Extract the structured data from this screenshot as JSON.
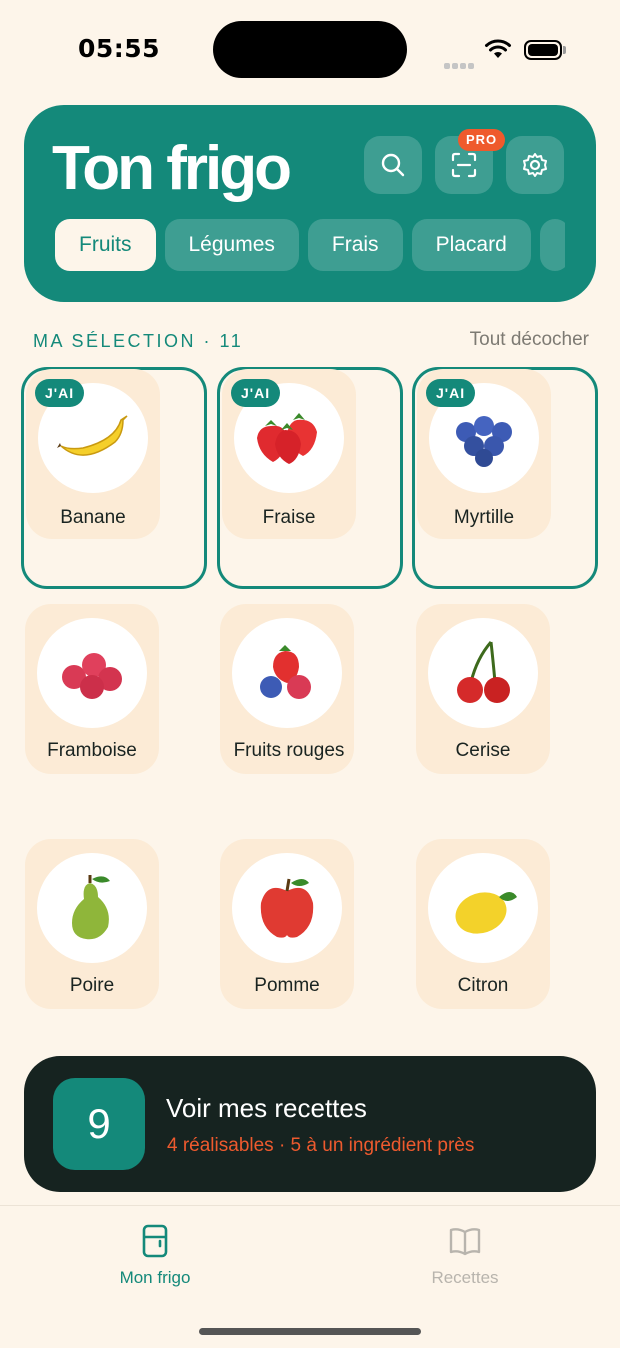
{
  "status_bar": {
    "time": "05:55"
  },
  "header": {
    "title": "Ton frigo",
    "search_icon": "search-icon",
    "scan_icon": "scan-icon",
    "settings_icon": "gear-icon",
    "pro_badge": "PRO",
    "tabs": [
      {
        "label": "Fruits",
        "active": true
      },
      {
        "label": "Légumes",
        "active": false
      },
      {
        "label": "Frais",
        "active": false
      },
      {
        "label": "Placard",
        "active": false
      }
    ]
  },
  "selection": {
    "title": "MA SÉLECTION · 11",
    "uncheck_all": "Tout décocher"
  },
  "items": [
    {
      "label": "Banane",
      "selected": true,
      "badge": "J'AI",
      "icon": "banana-icon"
    },
    {
      "label": "Fraise",
      "selected": true,
      "badge": "J'AI",
      "icon": "strawberry-icon"
    },
    {
      "label": "Myrtille",
      "selected": true,
      "badge": "J'AI",
      "icon": "blueberry-icon"
    },
    {
      "label": "Framboise",
      "selected": false,
      "icon": "raspberry-icon"
    },
    {
      "label": "Fruits rouges",
      "selected": false,
      "icon": "red-fruits-icon"
    },
    {
      "label": "Cerise",
      "selected": false,
      "icon": "cherry-icon"
    },
    {
      "label": "Poire",
      "selected": false,
      "icon": "pear-icon"
    },
    {
      "label": "Pomme",
      "selected": false,
      "icon": "apple-icon"
    },
    {
      "label": "Citron",
      "selected": false,
      "icon": "lemon-icon"
    }
  ],
  "cta": {
    "count": "9",
    "title": "Voir mes recettes",
    "subtitle": "4 réalisables · 5 à un ingrédient près"
  },
  "nav": {
    "items": [
      {
        "label": "Mon frigo",
        "icon": "fridge-icon",
        "active": true
      },
      {
        "label": "Recettes",
        "icon": "book-icon",
        "active": false
      }
    ]
  },
  "colors": {
    "accent": "#14897a",
    "background": "#fdf5ea",
    "tile": "#fcebd6",
    "cta_bg": "#162320",
    "orange": "#ee5a2e"
  }
}
